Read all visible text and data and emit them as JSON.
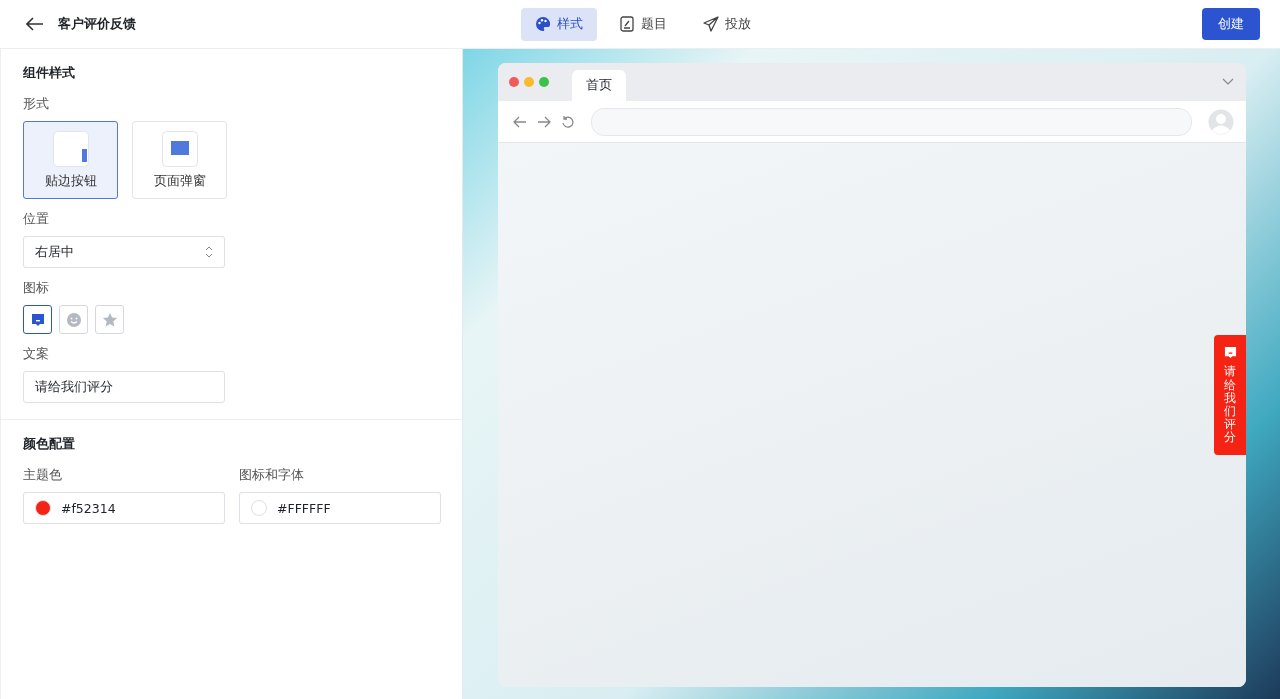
{
  "header": {
    "title": "客户评价反馈",
    "tabs": [
      {
        "label": "样式",
        "kind": "palette",
        "selected": true
      },
      {
        "label": "题目",
        "kind": "doc",
        "selected": false
      },
      {
        "label": "投放",
        "kind": "send",
        "selected": false
      }
    ],
    "create_button": "创建"
  },
  "style_section": {
    "title": "组件样式",
    "form_label": "形式",
    "forms": [
      {
        "label": "贴边按钮",
        "kind": "edge",
        "selected": true
      },
      {
        "label": "页面弹窗",
        "kind": "popup",
        "selected": false
      }
    ],
    "position_label": "位置",
    "position_value": "右居中",
    "icon_label": "图标",
    "icons": [
      {
        "kind": "message",
        "selected": true
      },
      {
        "kind": "smile",
        "selected": false
      },
      {
        "kind": "star",
        "selected": false
      }
    ],
    "copy_label": "文案",
    "copy_value": "请给我们评分"
  },
  "color_section": {
    "title": "颜色配置",
    "fields": [
      {
        "label": "主题色",
        "value": "#f52314",
        "color": "#f52314"
      },
      {
        "label": "图标和字体",
        "value": "#FFFFFF",
        "color": "#ffffff"
      }
    ]
  },
  "preview": {
    "tab": "首页",
    "feedback_text": "请给我们评分"
  }
}
